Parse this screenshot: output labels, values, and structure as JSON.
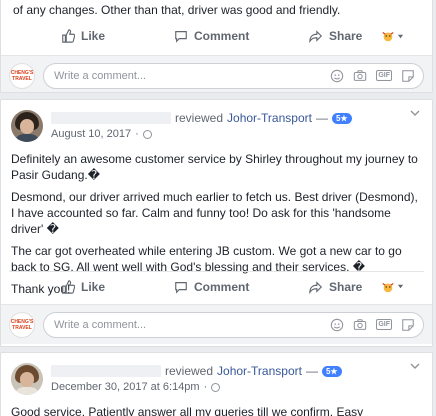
{
  "top_card": {
    "text_fragment": "of any changes. Other than that, driver was good and friendly.",
    "actions": {
      "like": "Like",
      "comment": "Comment",
      "share": "Share"
    },
    "logo_text": "CHENG'S TRAVEL",
    "comment_placeholder": "Write a comment..."
  },
  "review1": {
    "reviewed": "reviewed",
    "page": "Johor-Transport",
    "separator": "—",
    "badge": "5★",
    "date": "August 10, 2017",
    "dot": "·",
    "paragraphs": [
      "Definitely an awesome customer service by Shirley throughout my journey to Pasir Gudang.�",
      "Desmond, our driver arrived much earlier to fetch us. Best driver (Desmond), I have accounted so far. Calm and funny too! Do ask for this 'handsome driver' �",
      "The car got overheated while entering JB custom. We got a new car to go back to SG. All went well with God's blessing and their services. �",
      "Thank you!"
    ],
    "actions": {
      "like": "Like",
      "comment": "Comment",
      "share": "Share"
    },
    "comment_placeholder": "Write a comment..."
  },
  "review2": {
    "reviewed": "reviewed",
    "page": "Johor-Transport",
    "separator": "—",
    "badge": "5★",
    "date": "December 30, 2017 at 6:14pm",
    "dot": "·",
    "text": "Good service. Patiently answer all my queries till we confirm. Easy transactions &"
  },
  "colors": {
    "link": "#385898",
    "badge": "#4080ff",
    "bg": "#e9ebee"
  }
}
